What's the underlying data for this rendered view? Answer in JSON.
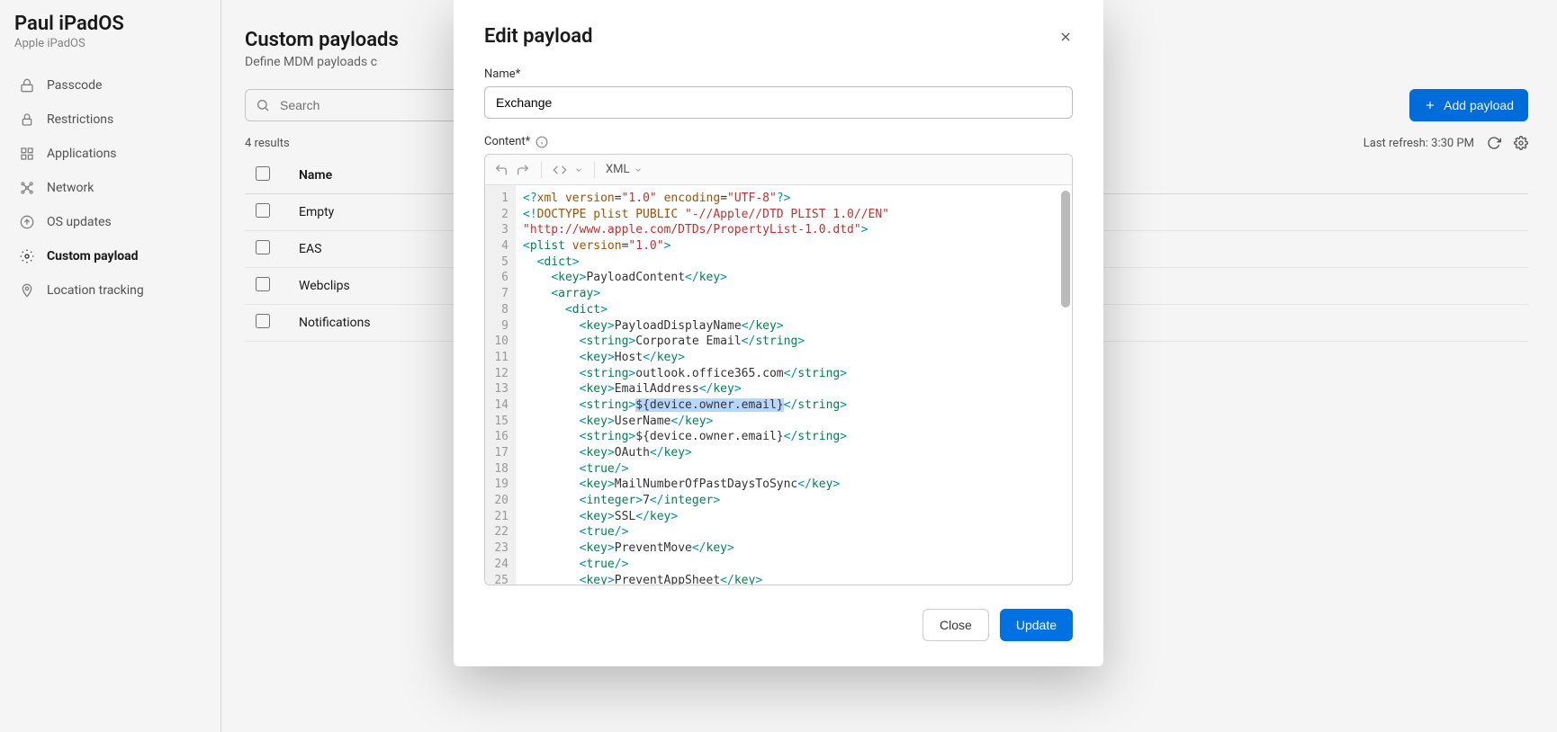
{
  "sidebar": {
    "title": "Paul iPadOS",
    "subtitle": "Apple iPadOS",
    "items": [
      {
        "label": "Passcode",
        "active": false
      },
      {
        "label": "Restrictions",
        "active": false
      },
      {
        "label": "Applications",
        "active": false
      },
      {
        "label": "Network",
        "active": false
      },
      {
        "label": "OS updates",
        "active": false
      },
      {
        "label": "Custom payload",
        "active": true
      },
      {
        "label": "Location tracking",
        "active": false
      }
    ]
  },
  "main": {
    "heading": "Custom payloads",
    "subheading": "Define MDM payloads c",
    "search_placeholder": "Search",
    "add_button": "Add payload",
    "results_text": "4 results",
    "refresh_text": "Last refresh: 3:30 PM",
    "table": {
      "header": "Name",
      "rows": [
        "Empty",
        "EAS",
        "Webclips",
        "Notifications"
      ]
    }
  },
  "modal": {
    "title": "Edit payload",
    "name_label": "Name*",
    "name_value": "Exchange",
    "content_label": "Content*",
    "language": "XML",
    "close_button": "Close",
    "update_button": "Update",
    "line_count": 25,
    "code_lines": [
      {
        "parts": [
          {
            "cls": "t-decl",
            "txt": "<?"
          },
          {
            "cls": "t-name",
            "txt": "xml "
          },
          {
            "cls": "t-attr",
            "txt": "version"
          },
          {
            "cls": "t-text",
            "txt": "="
          },
          {
            "cls": "t-str",
            "txt": "\"1.0\""
          },
          {
            "cls": "t-text",
            "txt": " "
          },
          {
            "cls": "t-attr",
            "txt": "encoding"
          },
          {
            "cls": "t-text",
            "txt": "="
          },
          {
            "cls": "t-str",
            "txt": "\"UTF-8\""
          },
          {
            "cls": "t-decl",
            "txt": "?>"
          }
        ]
      },
      {
        "parts": [
          {
            "cls": "t-decl",
            "txt": "<!"
          },
          {
            "cls": "t-name",
            "txt": "DOCTYPE plist PUBLIC "
          },
          {
            "cls": "t-str",
            "txt": "\"-//Apple//DTD PLIST 1.0//EN\" "
          }
        ]
      },
      {
        "parts": [
          {
            "cls": "t-str",
            "txt": "\"http://www.apple.com/DTDs/PropertyList-1.0.dtd\""
          },
          {
            "cls": "t-decl",
            "txt": ">"
          }
        ]
      },
      {
        "parts": [
          {
            "cls": "t-punc",
            "txt": "<"
          },
          {
            "cls": "t-tag",
            "txt": "plist "
          },
          {
            "cls": "t-attr",
            "txt": "version"
          },
          {
            "cls": "t-text",
            "txt": "="
          },
          {
            "cls": "t-str",
            "txt": "\"1.0\""
          },
          {
            "cls": "t-punc",
            "txt": ">"
          }
        ]
      },
      {
        "indent": 1,
        "parts": [
          {
            "cls": "t-punc",
            "txt": "<"
          },
          {
            "cls": "t-tag",
            "txt": "dict"
          },
          {
            "cls": "t-punc",
            "txt": ">"
          }
        ]
      },
      {
        "indent": 2,
        "parts": [
          {
            "cls": "t-punc",
            "txt": "<"
          },
          {
            "cls": "t-tag",
            "txt": "key"
          },
          {
            "cls": "t-punc",
            "txt": ">"
          },
          {
            "cls": "t-text",
            "txt": "PayloadContent"
          },
          {
            "cls": "t-punc",
            "txt": "</"
          },
          {
            "cls": "t-tag",
            "txt": "key"
          },
          {
            "cls": "t-punc",
            "txt": ">"
          }
        ]
      },
      {
        "indent": 2,
        "parts": [
          {
            "cls": "t-punc",
            "txt": "<"
          },
          {
            "cls": "t-tag",
            "txt": "array"
          },
          {
            "cls": "t-punc",
            "txt": ">"
          }
        ]
      },
      {
        "indent": 3,
        "parts": [
          {
            "cls": "t-punc",
            "txt": "<"
          },
          {
            "cls": "t-tag",
            "txt": "dict"
          },
          {
            "cls": "t-punc",
            "txt": ">"
          }
        ]
      },
      {
        "indent": 4,
        "parts": [
          {
            "cls": "t-punc",
            "txt": "<"
          },
          {
            "cls": "t-tag",
            "txt": "key"
          },
          {
            "cls": "t-punc",
            "txt": ">"
          },
          {
            "cls": "t-text",
            "txt": "PayloadDisplayName"
          },
          {
            "cls": "t-punc",
            "txt": "</"
          },
          {
            "cls": "t-tag",
            "txt": "key"
          },
          {
            "cls": "t-punc",
            "txt": ">"
          }
        ]
      },
      {
        "indent": 4,
        "parts": [
          {
            "cls": "t-punc",
            "txt": "<"
          },
          {
            "cls": "t-tag",
            "txt": "string"
          },
          {
            "cls": "t-punc",
            "txt": ">"
          },
          {
            "cls": "t-text",
            "txt": "Corporate Email"
          },
          {
            "cls": "t-punc",
            "txt": "</"
          },
          {
            "cls": "t-tag",
            "txt": "string"
          },
          {
            "cls": "t-punc",
            "txt": ">"
          }
        ]
      },
      {
        "indent": 4,
        "parts": [
          {
            "cls": "t-punc",
            "txt": "<"
          },
          {
            "cls": "t-tag",
            "txt": "key"
          },
          {
            "cls": "t-punc",
            "txt": ">"
          },
          {
            "cls": "t-text",
            "txt": "Host"
          },
          {
            "cls": "t-punc",
            "txt": "</"
          },
          {
            "cls": "t-tag",
            "txt": "key"
          },
          {
            "cls": "t-punc",
            "txt": ">"
          }
        ]
      },
      {
        "indent": 4,
        "parts": [
          {
            "cls": "t-punc",
            "txt": "<"
          },
          {
            "cls": "t-tag",
            "txt": "string"
          },
          {
            "cls": "t-punc",
            "txt": ">"
          },
          {
            "cls": "t-text",
            "txt": "outlook.office365.com"
          },
          {
            "cls": "t-punc",
            "txt": "</"
          },
          {
            "cls": "t-tag",
            "txt": "string"
          },
          {
            "cls": "t-punc",
            "txt": ">"
          }
        ]
      },
      {
        "indent": 4,
        "parts": [
          {
            "cls": "t-punc",
            "txt": "<"
          },
          {
            "cls": "t-tag",
            "txt": "key"
          },
          {
            "cls": "t-punc",
            "txt": ">"
          },
          {
            "cls": "t-text",
            "txt": "EmailAddress"
          },
          {
            "cls": "t-punc",
            "txt": "</"
          },
          {
            "cls": "t-tag",
            "txt": "key"
          },
          {
            "cls": "t-punc",
            "txt": ">"
          }
        ]
      },
      {
        "indent": 4,
        "parts": [
          {
            "cls": "t-punc",
            "txt": "<"
          },
          {
            "cls": "t-tag",
            "txt": "string"
          },
          {
            "cls": "t-punc",
            "txt": ">"
          },
          {
            "cls": "t-var sel",
            "txt": "${device.owner.email}"
          },
          {
            "cls": "t-punc",
            "txt": "</"
          },
          {
            "cls": "t-tag",
            "txt": "string"
          },
          {
            "cls": "t-punc",
            "txt": ">"
          }
        ]
      },
      {
        "indent": 4,
        "parts": [
          {
            "cls": "t-punc",
            "txt": "<"
          },
          {
            "cls": "t-tag",
            "txt": "key"
          },
          {
            "cls": "t-punc",
            "txt": ">"
          },
          {
            "cls": "t-text",
            "txt": "UserName"
          },
          {
            "cls": "t-punc",
            "txt": "</"
          },
          {
            "cls": "t-tag",
            "txt": "key"
          },
          {
            "cls": "t-punc",
            "txt": ">"
          }
        ]
      },
      {
        "indent": 4,
        "parts": [
          {
            "cls": "t-punc",
            "txt": "<"
          },
          {
            "cls": "t-tag",
            "txt": "string"
          },
          {
            "cls": "t-punc",
            "txt": ">"
          },
          {
            "cls": "t-var",
            "txt": "${device.owner.email}"
          },
          {
            "cls": "t-punc",
            "txt": "</"
          },
          {
            "cls": "t-tag",
            "txt": "string"
          },
          {
            "cls": "t-punc",
            "txt": ">"
          }
        ]
      },
      {
        "indent": 4,
        "parts": [
          {
            "cls": "t-punc",
            "txt": "<"
          },
          {
            "cls": "t-tag",
            "txt": "key"
          },
          {
            "cls": "t-punc",
            "txt": ">"
          },
          {
            "cls": "t-text",
            "txt": "OAuth"
          },
          {
            "cls": "t-punc",
            "txt": "</"
          },
          {
            "cls": "t-tag",
            "txt": "key"
          },
          {
            "cls": "t-punc",
            "txt": ">"
          }
        ]
      },
      {
        "indent": 4,
        "parts": [
          {
            "cls": "t-punc",
            "txt": "<"
          },
          {
            "cls": "t-tag",
            "txt": "true"
          },
          {
            "cls": "t-punc",
            "txt": "/>"
          }
        ]
      },
      {
        "indent": 4,
        "parts": [
          {
            "cls": "t-punc",
            "txt": "<"
          },
          {
            "cls": "t-tag",
            "txt": "key"
          },
          {
            "cls": "t-punc",
            "txt": ">"
          },
          {
            "cls": "t-text",
            "txt": "MailNumberOfPastDaysToSync"
          },
          {
            "cls": "t-punc",
            "txt": "</"
          },
          {
            "cls": "t-tag",
            "txt": "key"
          },
          {
            "cls": "t-punc",
            "txt": ">"
          }
        ]
      },
      {
        "indent": 4,
        "parts": [
          {
            "cls": "t-punc",
            "txt": "<"
          },
          {
            "cls": "t-tag",
            "txt": "integer"
          },
          {
            "cls": "t-punc",
            "txt": ">"
          },
          {
            "cls": "t-text",
            "txt": "7"
          },
          {
            "cls": "t-punc",
            "txt": "</"
          },
          {
            "cls": "t-tag",
            "txt": "integer"
          },
          {
            "cls": "t-punc",
            "txt": ">"
          }
        ]
      },
      {
        "indent": 4,
        "parts": [
          {
            "cls": "t-punc",
            "txt": "<"
          },
          {
            "cls": "t-tag",
            "txt": "key"
          },
          {
            "cls": "t-punc",
            "txt": ">"
          },
          {
            "cls": "t-text",
            "txt": "SSL"
          },
          {
            "cls": "t-punc",
            "txt": "</"
          },
          {
            "cls": "t-tag",
            "txt": "key"
          },
          {
            "cls": "t-punc",
            "txt": ">"
          }
        ]
      },
      {
        "indent": 4,
        "parts": [
          {
            "cls": "t-punc",
            "txt": "<"
          },
          {
            "cls": "t-tag",
            "txt": "true"
          },
          {
            "cls": "t-punc",
            "txt": "/>"
          }
        ]
      },
      {
        "indent": 4,
        "parts": [
          {
            "cls": "t-punc",
            "txt": "<"
          },
          {
            "cls": "t-tag",
            "txt": "key"
          },
          {
            "cls": "t-punc",
            "txt": ">"
          },
          {
            "cls": "t-text",
            "txt": "PreventMove"
          },
          {
            "cls": "t-punc",
            "txt": "</"
          },
          {
            "cls": "t-tag",
            "txt": "key"
          },
          {
            "cls": "t-punc",
            "txt": ">"
          }
        ]
      },
      {
        "indent": 4,
        "parts": [
          {
            "cls": "t-punc",
            "txt": "<"
          },
          {
            "cls": "t-tag",
            "txt": "true"
          },
          {
            "cls": "t-punc",
            "txt": "/>"
          }
        ]
      },
      {
        "indent": 4,
        "parts": [
          {
            "cls": "t-punc",
            "txt": "<"
          },
          {
            "cls": "t-tag",
            "txt": "key"
          },
          {
            "cls": "t-punc",
            "txt": ">"
          },
          {
            "cls": "t-text",
            "txt": "PreventAppSheet"
          },
          {
            "cls": "t-punc",
            "txt": "</"
          },
          {
            "cls": "t-tag",
            "txt": "key"
          },
          {
            "cls": "t-punc",
            "txt": ">"
          }
        ]
      }
    ]
  }
}
